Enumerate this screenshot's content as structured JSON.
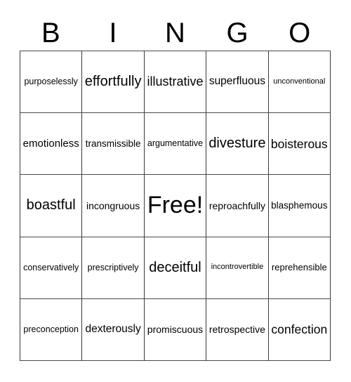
{
  "card": {
    "title_letters": [
      "B",
      "I",
      "N",
      "G",
      "O"
    ],
    "free_space_label": "Free!",
    "grid_size": "5x5",
    "line_color": "#3a3a3a",
    "background_color": "#ffffff",
    "text_color": "#000000",
    "rows": [
      [
        {
          "text": "purposelessly",
          "size": "s-sm"
        },
        {
          "text": "effortfully",
          "size": "s-xxl"
        },
        {
          "text": "illustrative",
          "size": "s-xl"
        },
        {
          "text": "superfluous",
          "size": "s-lg"
        },
        {
          "text": "unconventional",
          "size": "s-xs"
        }
      ],
      [
        {
          "text": "emotionless",
          "size": "s-lg"
        },
        {
          "text": "transmissible",
          "size": "s-md"
        },
        {
          "text": "argumentative",
          "size": "s-sm"
        },
        {
          "text": "divesture",
          "size": "s-xxl"
        },
        {
          "text": "boisterous",
          "size": "s-xl"
        }
      ],
      [
        {
          "text": "boastful",
          "size": "s-xxl"
        },
        {
          "text": "incongruous",
          "size": "s-md"
        },
        {
          "text": "Free!",
          "size": "s-free"
        },
        {
          "text": "reproachfully",
          "size": "s-md"
        },
        {
          "text": "blasphemous",
          "size": "s-md"
        }
      ],
      [
        {
          "text": "conservatively",
          "size": "s-sm"
        },
        {
          "text": "prescriptively",
          "size": "s-sm"
        },
        {
          "text": "deceitful",
          "size": "s-xxl"
        },
        {
          "text": "incontrovertible",
          "size": "s-xs"
        },
        {
          "text": "reprehensible",
          "size": "s-md"
        }
      ],
      [
        {
          "text": "preconception",
          "size": "s-sm"
        },
        {
          "text": "dexterously",
          "size": "s-xl"
        },
        {
          "text": "promiscuous",
          "size": "s-md"
        },
        {
          "text": "retrospective",
          "size": "s-md"
        },
        {
          "text": "confection",
          "size": "s-xl"
        }
      ]
    ]
  }
}
